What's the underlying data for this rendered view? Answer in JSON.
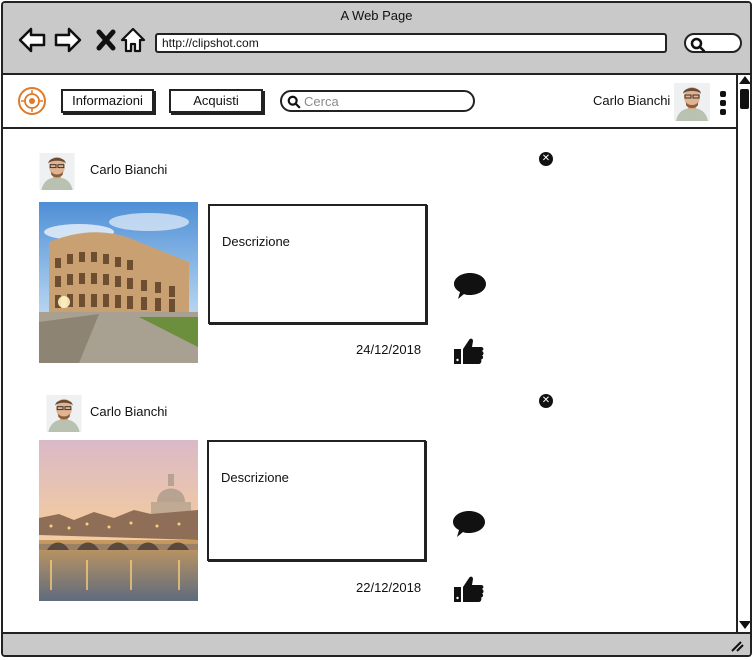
{
  "window": {
    "title": "A Web Page",
    "url": "http://clipshot.com"
  },
  "nav": {
    "back_icon": "back-arrow-icon",
    "forward_icon": "forward-arrow-icon",
    "stop_icon": "close-icon",
    "home_icon": "home-icon"
  },
  "header": {
    "buttons": [
      {
        "label": "Informazioni"
      },
      {
        "label": "Acquisti"
      }
    ],
    "search": {
      "placeholder": "Cerca",
      "value": ""
    },
    "user": {
      "name": "Carlo Bianchi"
    }
  },
  "feed": {
    "posts": [
      {
        "author": "Carlo Bianchi",
        "description": "Descrizione",
        "date": "24/12/2018",
        "image": "colosseum-photo"
      },
      {
        "author": "Carlo Bianchi",
        "description": "Descrizione",
        "date": "22/12/2018",
        "image": "rome-st-peters-photo"
      }
    ]
  },
  "colors": {
    "chrome": "#c9c9c9",
    "ink": "#111111",
    "logo": "#e07a2b"
  }
}
